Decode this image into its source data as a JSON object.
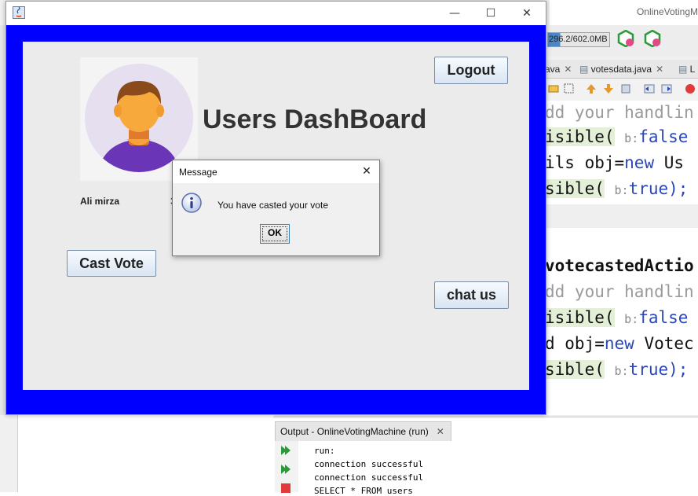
{
  "ide": {
    "title": "OnlineVotingM",
    "memory": "296.2/602.0MB",
    "editor_tabs": [
      {
        "label": "ava"
      },
      {
        "label": "votesdata.java"
      },
      {
        "label": "L"
      }
    ],
    "code_lines": [
      {
        "prefix": "",
        "comment": "dd your handlin",
        "rest": "",
        "hl": false
      },
      {
        "prefix": "isible(",
        "hint": "b:",
        "rest": "false",
        "hl": true
      },
      {
        "prefix": "ils obj=",
        "kw": "new",
        "rest": " Us",
        "hl": false
      },
      {
        "prefix": "sible(",
        "hint": "b:",
        "rest": "true);",
        "hl": true
      },
      {
        "prefix": "votecastedActio",
        "hl": false
      },
      {
        "prefix": "",
        "comment": "dd your handlin",
        "hl": false
      },
      {
        "prefix": "isible(",
        "hint": "b:",
        "rest": "false",
        "hl": true
      },
      {
        "prefix": "d obj=",
        "kw": "new",
        "rest": " Votec",
        "hl": false
      },
      {
        "prefix": "sible(",
        "hint": "b:",
        "rest": "true);",
        "hl": true
      }
    ],
    "output": {
      "tab_label": "Output - OnlineVotingMachine (run)",
      "lines": [
        "run:",
        "connection successful",
        "connection successful",
        "SELECT * FROM users"
      ]
    }
  },
  "app": {
    "title": "",
    "dashboard_title": "Users DashBoard",
    "user_name": "Ali mirza",
    "user_extra": "3",
    "buttons": {
      "logout": "Logout",
      "cast_vote": "Cast Vote",
      "chat": "chat us"
    },
    "colors": {
      "frame": "#0000ff",
      "panel": "#ebebeb"
    }
  },
  "dialog": {
    "title": "Message",
    "message": "You have casted your vote",
    "ok_label": "OK",
    "icon": "information-icon"
  }
}
